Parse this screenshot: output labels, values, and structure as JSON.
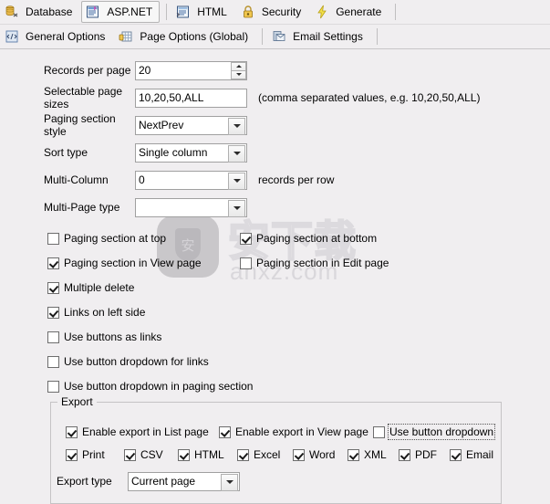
{
  "toolbar_main": {
    "items": [
      {
        "label": "Database",
        "icon": "database-icon",
        "selected": false,
        "sep_after": false
      },
      {
        "label": "ASP.NET",
        "icon": "aspnet-icon",
        "selected": true,
        "sep_after": true
      },
      {
        "label": "HTML",
        "icon": "html-icon",
        "selected": false,
        "sep_after": false
      },
      {
        "label": "Security",
        "icon": "lock-icon",
        "selected": false,
        "sep_after": false
      },
      {
        "label": "Generate",
        "icon": "lightning-icon",
        "selected": false,
        "sep_after": true
      }
    ]
  },
  "toolbar_sub": {
    "items": [
      {
        "label": "General Options",
        "icon": "general-options-icon",
        "selected": false,
        "sep_after": false
      },
      {
        "label": "Page Options (Global)",
        "icon": "page-options-icon",
        "selected": false,
        "sep_after": true
      },
      {
        "label": "Email Settings",
        "icon": "email-settings-icon",
        "selected": false,
        "sep_after": true
      }
    ]
  },
  "fields": {
    "records_per_page": {
      "label": "Records per page",
      "value": "20"
    },
    "selectable_page_sizes": {
      "label": "Selectable page sizes",
      "value": "10,20,50,ALL",
      "hint": "(comma separated values, e.g.  10,20,50,ALL)"
    },
    "paging_section_style": {
      "label": "Paging section style",
      "value": "NextPrev"
    },
    "sort_type": {
      "label": "Sort type",
      "value": "Single column"
    },
    "multi_column": {
      "label": "Multi-Column",
      "value": "0",
      "suffix": "records per row"
    },
    "multi_page_type": {
      "label": "Multi-Page type",
      "value": ""
    }
  },
  "options": [
    {
      "label": "Paging section at top",
      "checked": false,
      "col": "left"
    },
    {
      "label": "Paging section at bottom",
      "checked": true,
      "col": "right"
    },
    {
      "label": "Paging section in View page",
      "checked": true,
      "col": "left"
    },
    {
      "label": "Paging section in Edit page",
      "checked": false,
      "col": "right"
    },
    {
      "label": "Multiple delete",
      "checked": true,
      "col": "left"
    },
    {
      "label": "Links on left side",
      "checked": true,
      "col": "left"
    },
    {
      "label": "Use buttons as links",
      "checked": false,
      "col": "left"
    },
    {
      "label": "Use button dropdown for links",
      "checked": false,
      "col": "left"
    },
    {
      "label": "Use button dropdown in paging section",
      "checked": false,
      "col": "left"
    }
  ],
  "export": {
    "title": "Export",
    "toggles": [
      {
        "label": "Enable export in List page",
        "checked": true,
        "focused": false
      },
      {
        "label": "Enable export in View page",
        "checked": true,
        "focused": false
      },
      {
        "label": "Use button dropdown",
        "checked": false,
        "focused": true
      }
    ],
    "formats": [
      {
        "label": "Print",
        "checked": true
      },
      {
        "label": "CSV",
        "checked": true
      },
      {
        "label": "HTML",
        "checked": true
      },
      {
        "label": "Excel",
        "checked": true
      },
      {
        "label": "Word",
        "checked": true
      },
      {
        "label": "XML",
        "checked": true
      },
      {
        "label": "PDF",
        "checked": true
      },
      {
        "label": "Email",
        "checked": true
      }
    ],
    "export_type": {
      "label": "Export type",
      "value": "Current page"
    }
  },
  "watermark": {
    "glyph": "安",
    "text_cn": "安下载",
    "domain": "anxz.com"
  }
}
